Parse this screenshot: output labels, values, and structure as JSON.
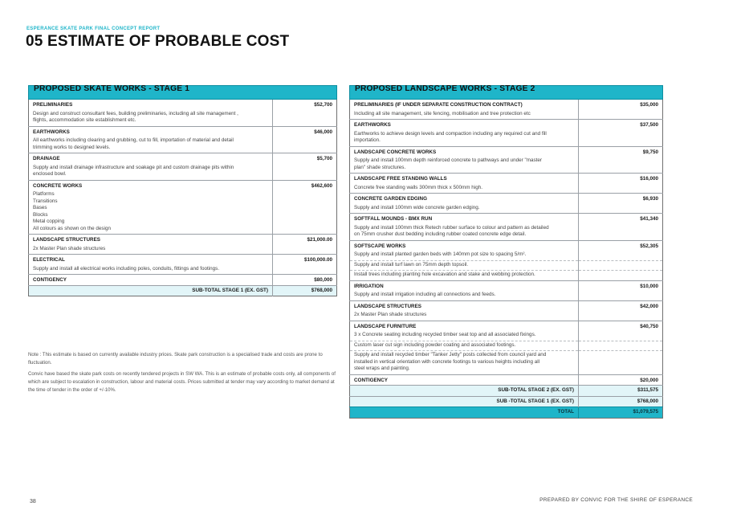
{
  "header": {
    "kicker": "ESPERANCE SKATE PARK FINAL CONCEPT REPORT",
    "title": "05 ESTIMATE OF PROBABLE COST"
  },
  "stage1": {
    "heading": "PROPOSED SKATE WORKS - STAGE 1",
    "items": [
      {
        "name": "PRELIMINARIES",
        "amount": "$52,700",
        "desc": [
          "Design and construct consultant fees, building preliminaries, including all site management ,",
          "flights, accommodation site establishment etc."
        ]
      },
      {
        "name": "EARTHWORKS",
        "amount": "$46,000",
        "desc": [
          "All earthworks including clearing and grubbing, cut to fill, importation of material and detail",
          "trimming works to designed levels."
        ]
      },
      {
        "name": "DRAINAGE",
        "amount": "$5,700",
        "desc": [
          "Supply and install drainage infrastructure and soakage pit and custom drainage pits within",
          "enclosed bowl."
        ]
      },
      {
        "name": "CONCRETE WORKS",
        "amount": "$462,600",
        "desc": [
          "Platforms",
          "Transitions",
          "Bases",
          "Blocks",
          "Metal copping",
          "All colours as shown on the design"
        ]
      },
      {
        "name": "LANDSCAPE STRUCTURES",
        "amount": "$21,000.00",
        "desc": [
          "2x Master Plan shade structures"
        ]
      },
      {
        "name": "ELECTRICAL",
        "amount": "$100,000.00",
        "desc": [
          "Supply and install all electrical works including poles, conduits, fittings and footings."
        ]
      },
      {
        "name": "CONTIGENCY",
        "amount": "$80,000",
        "desc": []
      }
    ],
    "subtotal_label": "SUB-TOTAL STAGE 1 (EX. GST)",
    "subtotal_amount": "$768,000"
  },
  "notes": [
    "Note : This estimate is based on currently available industry prices. Skate park construction is a specialised trade and costs are prone to fluctuation.",
    "Convic have based the skate park costs on recently tendered projects in SW WA. This is an estimate of probable costs only, all components of which are subject to escalation in construction, labour and material costs. Prices submitted at tender may vary according to market demand at the time of tender in the order of +/-10%."
  ],
  "stage2": {
    "heading": "PROPOSED LANDSCAPE WORKS - STAGE 2",
    "items": [
      {
        "name": "PRELIMINARIES (IF UNDER SEPARATE CONSTRUCTION CONTRACT)",
        "amount": "$35,000",
        "desc": [
          "Including all site management, site fencing, mobilisation and tree protection etc"
        ]
      },
      {
        "name": "EARTHWORKS",
        "amount": "$37,500",
        "desc": [
          "Earthworks to achieve design levels and compaction including any required cut and fill",
          "importation."
        ]
      },
      {
        "name": "LANDSCAPE CONCRETE WORKS",
        "amount": "$9,750",
        "desc": [
          "Supply and install 100mm depth reinforced concrete to pathways and under \"master",
          "plan\" shade structures."
        ]
      },
      {
        "name": "LANDSCAPE FREE STANDING WALLS",
        "amount": "$16,000",
        "desc": [
          "Concrete free standing walls 300mm thick x 500mm high."
        ]
      },
      {
        "name": "CONCRETE GARDEN EDGING",
        "amount": "$6,930",
        "desc": [
          "Supply and install 100mm wide concrete garden edging."
        ]
      },
      {
        "name": "SOFTFALL MOUNDS - BMX RUN",
        "amount": "$41,340",
        "desc": [
          "Supply and install 100mm thick Retech rubber surface to colour and pattern as detailed",
          "on 75mm crusher dust bedding including rubber coated concrete edge detail."
        ]
      },
      {
        "name": "SOFTSCAPE WORKS",
        "amount": "$52,305",
        "paras": [
          [
            "Supply and install planted garden beds with 140mm pot size to spacing 5/m²."
          ],
          [
            "Supply and install turf lawn on 75mm depth topsoil."
          ],
          [
            "Install trees including planting hole excavation and stake and webbing protection."
          ]
        ]
      },
      {
        "name": "IRRIGATION",
        "amount": "$10,000",
        "desc": [
          "Supply and install irrigation including all connections and feeds."
        ]
      },
      {
        "name": "LANDSCAPE STRUCTURES",
        "amount": "$42,000",
        "desc": [
          "2x Master Plan shade structures"
        ]
      },
      {
        "name": "LANDSCAPE FURNITURE",
        "amount": "$40,750",
        "paras": [
          [
            "3 x Concrete seating including recycled timber seat top and all associated fixings."
          ],
          [
            "Custom laser cut sign including powder coating and associated footings."
          ],
          [
            "Supply and install recycled timber \"Tanker Jetty\" posts collected from council yard and",
            "installed in vertical orientation with concrete footings to various heights including all",
            "steel wraps and painting."
          ]
        ]
      },
      {
        "name": "CONTIGENCY",
        "amount": "$20,000"
      }
    ],
    "subtotal2_label": "SUB-TOTAL STAGE 2 (EX. GST)",
    "subtotal2_amount": "$311,575",
    "subtotal1_label": "SUB -TOTAL STAGE 1 (EX. GST)",
    "subtotal1_amount": "$768,000",
    "total_label": "TOTAL",
    "total_amount": "$1,079,575"
  },
  "footer": {
    "page_number": "38",
    "prepared_by": "PREPARED BY CONVIC FOR THE SHIRE OF ESPERANCE"
  },
  "colors": {
    "accent": "#1fb5c9",
    "subtotal_bg": "#e2f5f8"
  }
}
